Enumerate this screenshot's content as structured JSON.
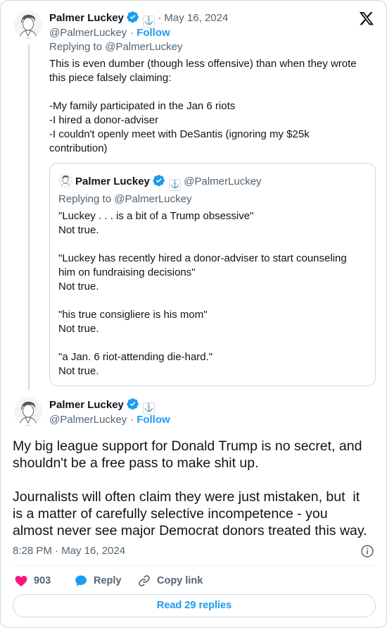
{
  "tweet1": {
    "name": "Palmer Luckey",
    "date": "· May 16, 2024",
    "handle": "@PalmerLuckey",
    "handle_sep": "·",
    "follow": "Follow",
    "replying": "Replying to @PalmerLuckey",
    "text": "This is even dumber (though less offensive) than when they wrote\nthis piece falsely claiming:\n\n-My family participated in the Jan 6 riots\n-I hired a donor-adviser\n-I couldn't openly meet with DeSantis (ignoring my $25k\ncontribution)"
  },
  "quote": {
    "name": "Palmer Luckey",
    "handle": "@PalmerLuckey",
    "replying": "Replying to @PalmerLuckey",
    "text": "\"Luckey . . . is a bit of a Trump obsessive\"\nNot true.\n\n\"Luckey has recently hired a donor-adviser to start counseling\nhim on fundraising decisions\"\nNot true.\n\n\"his true consigliere is his mom\"\nNot true.\n\n\"a Jan. 6 riot-attending die-hard.\"\nNot true."
  },
  "tweet2": {
    "name": "Palmer Luckey",
    "handle": "@PalmerLuckey",
    "handle_sep": "·",
    "follow": "Follow",
    "text": "My big league support for Donald Trump is no secret, and\nshouldn't be a free pass to make shit up.\n\nJournalists will often claim they were just mistaken, but  it\nis a matter of carefully selective incompetence - you\nalmost never see major Democrat donors treated this way.",
    "timestamp": "8:28 PM · May 16, 2024"
  },
  "actions": {
    "likes": "903",
    "reply": "Reply",
    "copy_link": "Copy link",
    "read_replies": "Read 29 replies"
  },
  "colors": {
    "accent": "#1d9bf0",
    "like": "#f91880",
    "muted": "#536471"
  },
  "icons": [
    "x-logo-icon",
    "verified-badge-icon",
    "affiliate-badge-icon",
    "info-icon",
    "heart-icon",
    "reply-bubble-icon",
    "link-icon"
  ]
}
